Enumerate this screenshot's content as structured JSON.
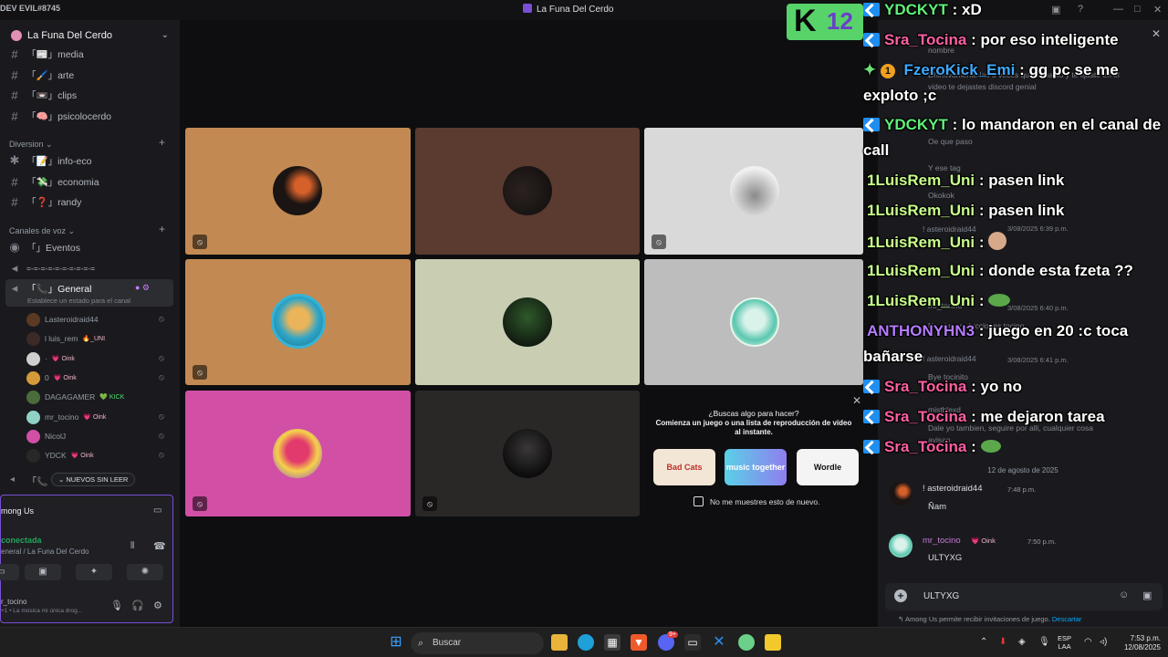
{
  "window": {
    "user_tag": "DEV EVIL#8745",
    "title": "La Funa Del Cerdo"
  },
  "sidebar": {
    "server_name": "La Funa Del Cerdo",
    "text_channels": [
      {
        "label": "「📰」media"
      },
      {
        "label": "「🖌️」arte"
      },
      {
        "label": "「📼」clips"
      },
      {
        "label": "「🧠」psicolocerdo"
      }
    ],
    "diversion_category": "Diversion",
    "diversion_channels": [
      {
        "label": "「📝」info-eco"
      },
      {
        "label": "「💸」economia"
      },
      {
        "label": "「❓」randy"
      }
    ],
    "voice_category": "Canales de voz",
    "voice_channels": [
      {
        "label": "「」Eventos"
      },
      {
        "label": "=-=-=-=-=-=-=-=-=-="
      },
      {
        "label": "「📞」General"
      }
    ],
    "voice_status_hint": "Establece un estado para el canal",
    "voice_users": [
      {
        "name": "Lasteroidraid44",
        "tag": ""
      },
      {
        "name": "l luis_rem",
        "tag": "🔥_UNI"
      },
      {
        "name": "·",
        "tag": "💗 Oink"
      },
      {
        "name": "0",
        "tag": "💗 Oink"
      },
      {
        "name": "DAGAGAMER",
        "tag": "💚 KICK"
      },
      {
        "name": "mr_tocino",
        "tag": "💗 Oink"
      },
      {
        "name": "NicolJ",
        "tag": ""
      },
      {
        "name": "YDCK",
        "tag": "💗 Oink"
      }
    ],
    "unread_label": "NUEVOS SIN LEER"
  },
  "user_panel": {
    "activity": "mong Us",
    "connection": "conectada",
    "location": "eneral / La Funa Del Cerdo",
    "username": "r_tocino",
    "status": "+1 • La música mi única drog..."
  },
  "activity_popup": {
    "question": "¿Buscas algo para hacer?",
    "description": "Comienza un juego o una lista de reproducción de vídeo al instante.",
    "apps": [
      "Bad Cats",
      "music together",
      "Wordle"
    ],
    "dont_show": "No me muestres esto de nuevo."
  },
  "chat": {
    "bg_messages": [
      "nombre",
      "Dhimivamente las 3 veces que te hablo y te fijaste en el",
      "video te dejastes discord genial",
      "Oe que paso",
      "Y ese tag",
      "Okokok",
      "! asteroidraid44",
      "3/08/2025 6:39 p.m.",
      "mr_tocino",
      "3/08/2025 6:40 p.m.",
      "No ni reproducciones tocino",
      "! asteroidraid44",
      "3/08/2025 6:41 p.m.",
      "Bye tocinito",
      "mistblexd",
      "Dale yo tambien, seguire por alli, cualquier cosa",
      "avisao"
    ],
    "date_divider": "12 de agosto de 2025",
    "messages": [
      {
        "name": "! asteroidraid44",
        "time": "7:48 p.m.",
        "text": "Ñam"
      },
      {
        "name": "mr_tocino",
        "badge": "💗 Oink",
        "time": "7:50 p.m.",
        "text": "ULTYXG"
      }
    ],
    "input_value": "ULTYXG",
    "invite_text": "Among Us permite recibir invitaciones de juego.",
    "invite_link": "Descartar"
  },
  "overlay": {
    "kick_number": "12",
    "lines": [
      {
        "user": "YDCKYT",
        "text": ": xD",
        "color": "green"
      },
      {
        "user": "Sra_Tocina",
        "text": ": por eso inteligente",
        "color": "pink"
      },
      {
        "user": "FzeroKick_Emi",
        "text": ": gg pc se me",
        "color": "blue"
      },
      {
        "user": "",
        "text": "exploto ;c",
        "color": ""
      },
      {
        "user": "YDCKYT",
        "text": ": lo mandaron en el canal de",
        "color": "green"
      },
      {
        "user": "",
        "text": "call",
        "color": ""
      },
      {
        "user": "1LuisRem_Uni",
        "text": ": pasen link",
        "color": "lime"
      },
      {
        "user": "1LuisRem_Uni",
        "text": ": pasen link",
        "color": "lime"
      },
      {
        "user": "1LuisRem_Uni",
        "text": ":",
        "color": "lime"
      },
      {
        "user": "1LuisRem_Uni",
        "text": ": donde esta fzeta ??",
        "color": "lime"
      },
      {
        "user": "1LuisRem_Uni",
        "text": ":",
        "color": "lime"
      },
      {
        "user": "ANTHONYHN3",
        "text": ": juego en 20 :c toca",
        "color": "purple"
      },
      {
        "user": "",
        "text": "bañarse",
        "color": ""
      },
      {
        "user": "Sra_Tocina",
        "text": ": yo no",
        "color": "pink"
      },
      {
        "user": "Sra_Tocina",
        "text": ": me dejaron tarea",
        "color": "pink"
      },
      {
        "user": "Sra_Tocina",
        "text": ":",
        "color": "pink"
      }
    ]
  },
  "taskbar": {
    "search_placeholder": "Buscar",
    "lang": "ESP",
    "lang_sub": "LAA",
    "time": "7:53 p.m.",
    "date": "12/08/2025",
    "discord_badge": "9+"
  },
  "colors": {
    "accent": "#7a4fd6",
    "tile_orange": "#c28a52",
    "tile_brown": "#5b3a30",
    "tile_light": "#d9d9d9",
    "tile_sage": "#c9cdb2",
    "tile_gray": "#bdbdbd",
    "tile_pink": "#d24fa6",
    "tile_dark": "#2a2727"
  }
}
